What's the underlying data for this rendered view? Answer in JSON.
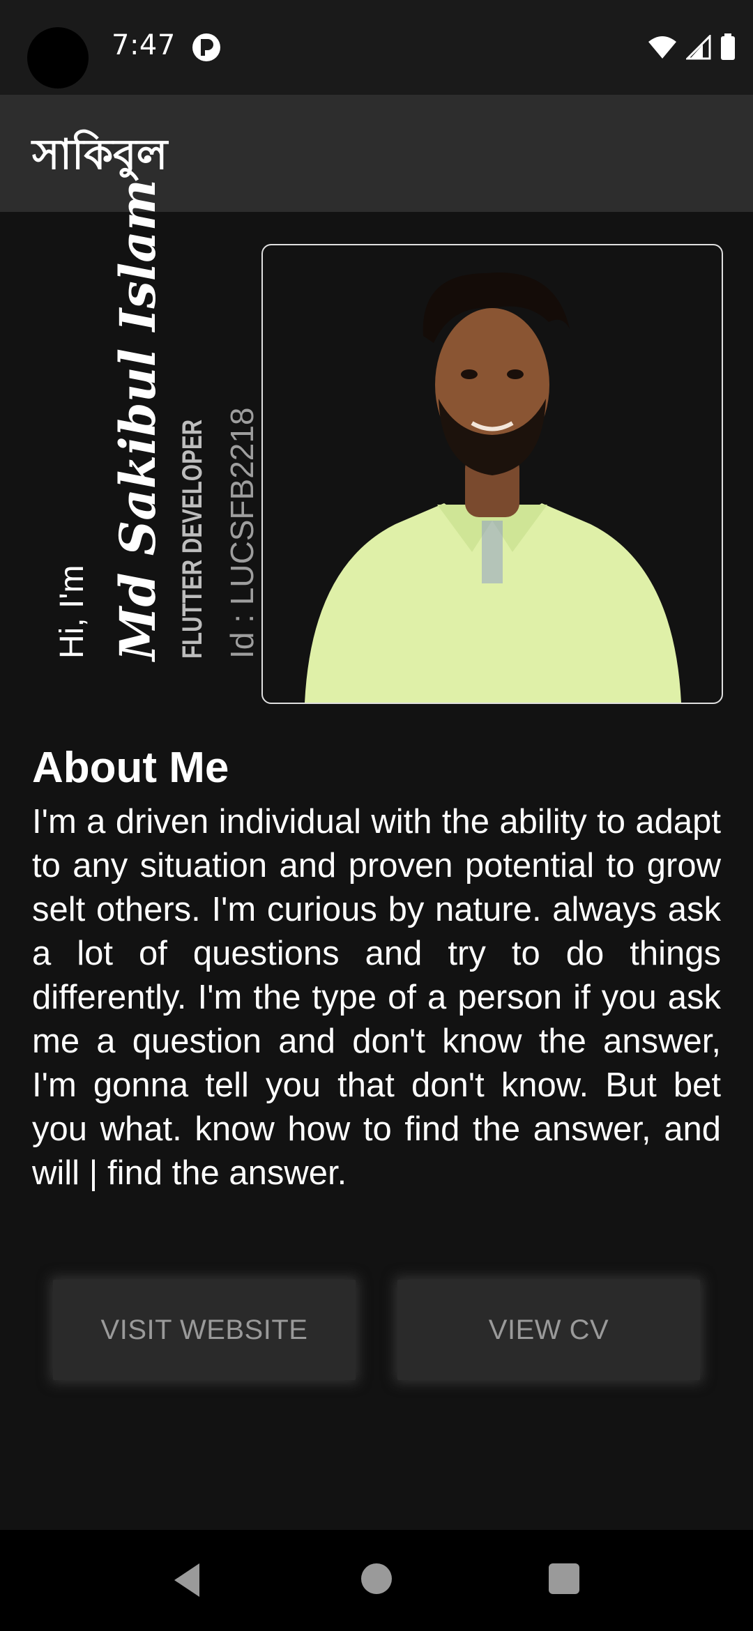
{
  "status_bar": {
    "time": "7:47",
    "app_icon": "circle-p-icon",
    "right_icons": [
      "wifi-icon",
      "signal-icon",
      "battery-icon"
    ]
  },
  "app_bar": {
    "title": "সাকিবুল"
  },
  "hero": {
    "greeting": "Hi, I'm",
    "name": "Md Sakibul Islam",
    "role": "FLUTTER DEVELOPER",
    "user_id": "Id : LUCSFB2218",
    "photo": "profile-photo"
  },
  "about": {
    "title": "About Me",
    "body": "I'm a driven individual with the ability to adapt to any situation and proven potential to grow selt others. I'm curious by nature. always ask a lot of questions and try to do things differently. I'm the type of a person if you ask me a question and don't know the answer, I'm gonna tell you that don't know. But bet you what. know how to find the answer, and will | find the answer."
  },
  "buttons": {
    "visit_website": "VISIT WEBSITE",
    "view_cv": "VIEW CV"
  },
  "nav": {
    "icons": [
      "back-icon",
      "home-icon",
      "recents-icon"
    ]
  },
  "colors": {
    "background": "#121212",
    "app_bar": "#2d2d2d",
    "button_bg": "#2a2a2a",
    "button_text": "#9a9a9a"
  }
}
